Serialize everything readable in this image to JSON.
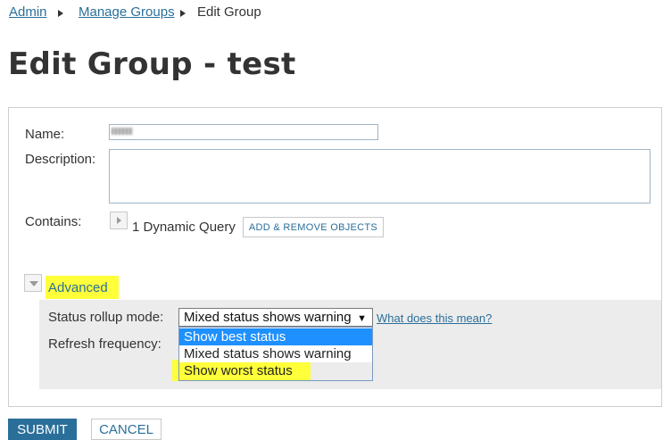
{
  "breadcrumb": {
    "items": [
      {
        "label": "Admin"
      },
      {
        "label": "Manage Groups"
      }
    ],
    "current": "Edit Group"
  },
  "page": {
    "title": "Edit Group - test"
  },
  "form": {
    "name_label": "Name:",
    "description_label": "Description:",
    "contains_label": "Contains:",
    "contains_value": "1 Dynamic Query",
    "add_remove_button": "ADD & REMOVE OBJECTS"
  },
  "advanced": {
    "label": "Advanced",
    "status_rollup_label": "Status rollup mode:",
    "status_rollup_selected": "Mixed status shows warning",
    "help_link": "What does this mean?",
    "refresh_label": "Refresh frequency:",
    "dropdown_options": [
      {
        "label": "Show best status"
      },
      {
        "label": "Mixed status shows warning"
      },
      {
        "label": "Show worst status"
      }
    ]
  },
  "actions": {
    "submit": "SUBMIT",
    "cancel": "CANCEL"
  },
  "colors": {
    "link": "#2a6f9a",
    "highlight": "#ffff3a",
    "selected_option": "#1e90ff",
    "submit_bg": "#2a6f9a"
  }
}
